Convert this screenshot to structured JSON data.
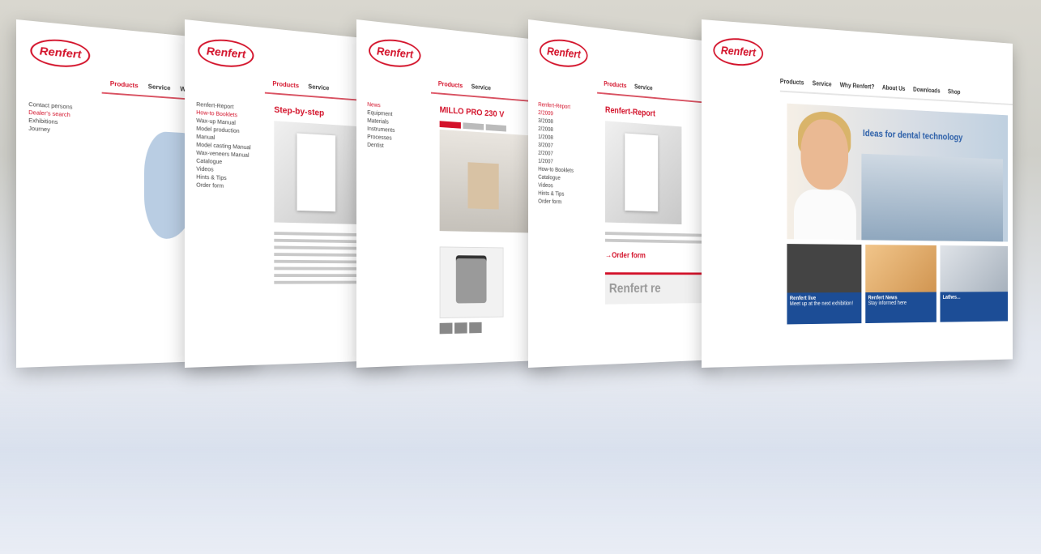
{
  "brand": {
    "logo_text": "Renfert",
    "accent": "#d3122a",
    "blue": "#1c4d96"
  },
  "page1": {
    "nav": [
      "Products",
      "Service",
      "W"
    ],
    "sidebar": [
      "Contact persons",
      "Dealer's search",
      "Exhibitions",
      "Journey"
    ]
  },
  "page2": {
    "nav": [
      "Products",
      "Service"
    ],
    "sidebar": [
      "Renfert-Report",
      "How-to Booklets",
      "Wax-up Manual",
      "Model production",
      "Manual",
      "Model casting Manual",
      "Wax-veneers Manual",
      "Catalogue",
      "Videos",
      "Hints & Tips",
      "Order form"
    ],
    "headline": "Step-by-step"
  },
  "page3": {
    "nav": [
      "Products",
      "Service"
    ],
    "sidebar": [
      "News",
      "Equipment",
      "Materials",
      "Instruments",
      "Processes",
      "Dentist"
    ],
    "headline": "MILLO PRO 230 V"
  },
  "page4": {
    "nav": [
      "Products",
      "Service"
    ],
    "sidebar": [
      "Renfert-Report",
      "2/2009",
      "3/2008",
      "2/2008",
      "1/2008",
      "3/2007",
      "2/2007",
      "1/2007",
      "How-to Booklets",
      "Catalogue",
      "Videos",
      "Hints & Tips",
      "Order form"
    ],
    "headline": "Renfert-Report",
    "order_link": "→Order form",
    "banner": "Renfert re"
  },
  "page5": {
    "nav": [
      "Products",
      "Service",
      "Why Renfert?",
      "About Us",
      "Downloads",
      "Shop"
    ],
    "hero_tag": "Ideas for dental technology",
    "teasers": [
      {
        "title": "Renfert live",
        "text": "Meet up at the next exhibition!"
      },
      {
        "title": "Renfert News",
        "text": "Stay informed here"
      },
      {
        "title": "Lathes...",
        "text": ""
      }
    ]
  }
}
